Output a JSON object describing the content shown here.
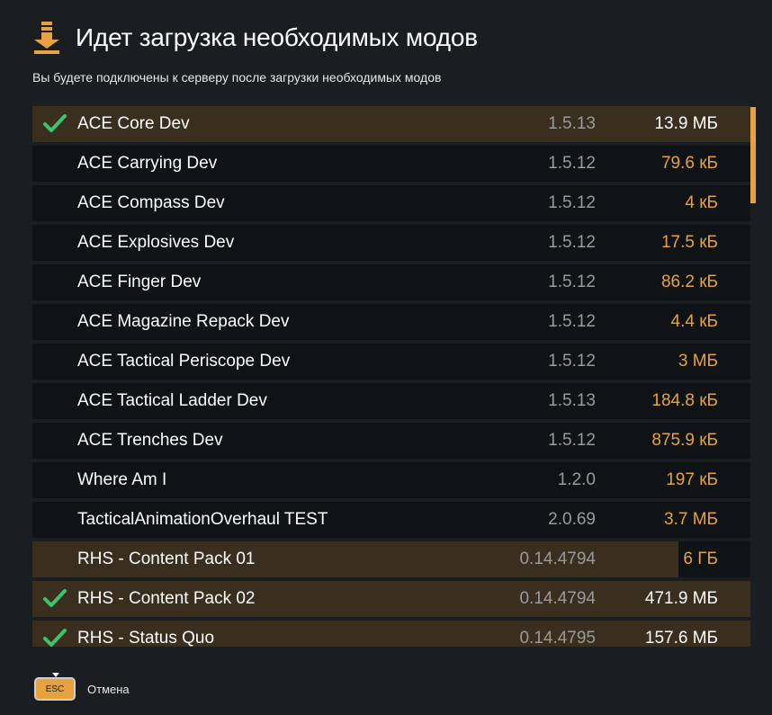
{
  "header": {
    "icon": "download-arrow-icon",
    "title": "Идет загрузка необходимых модов",
    "subtitle": "Вы будете подключены к серверу после загрузки необходимых модов"
  },
  "colors": {
    "accent": "#e6a23f",
    "check": "#3fc36a",
    "row_bg": "#0f1315",
    "row_progress": "#3a2f1e",
    "version_text": "#9a9a9a"
  },
  "mods": [
    {
      "name": "ACE Core Dev",
      "version": "1.5.13",
      "size": "13.9 МБ",
      "done": true,
      "progress": 1.0
    },
    {
      "name": "ACE Carrying Dev",
      "version": "1.5.12",
      "size": "79.6 кБ",
      "done": false,
      "progress": 0
    },
    {
      "name": "ACE Compass Dev",
      "version": "1.5.12",
      "size": "4 кБ",
      "done": false,
      "progress": 0
    },
    {
      "name": "ACE Explosives Dev",
      "version": "1.5.12",
      "size": "17.5 кБ",
      "done": false,
      "progress": 0
    },
    {
      "name": "ACE Finger Dev",
      "version": "1.5.12",
      "size": "86.2 кБ",
      "done": false,
      "progress": 0
    },
    {
      "name": "ACE Magazine Repack Dev",
      "version": "1.5.12",
      "size": "4.4 кБ",
      "done": false,
      "progress": 0
    },
    {
      "name": "ACE Tactical Periscope Dev",
      "version": "1.5.12",
      "size": "3 МБ",
      "done": false,
      "progress": 0
    },
    {
      "name": "ACE Tactical Ladder Dev",
      "version": "1.5.13",
      "size": "184.8 кБ",
      "done": false,
      "progress": 0
    },
    {
      "name": "ACE Trenches Dev",
      "version": "1.5.12",
      "size": "875.9 кБ",
      "done": false,
      "progress": 0
    },
    {
      "name": "Where Am I",
      "version": "1.2.0",
      "size": "197 кБ",
      "done": false,
      "progress": 0
    },
    {
      "name": "TacticalAnimationOverhaul TEST",
      "version": "2.0.69",
      "size": "3.7 МБ",
      "done": false,
      "progress": 0
    },
    {
      "name": "RHS - Content Pack 01",
      "version": "0.14.4794",
      "size": "6 ГБ",
      "done": false,
      "progress": 0.9
    },
    {
      "name": "RHS - Content Pack 02",
      "version": "0.14.4794",
      "size": "471.9 МБ",
      "done": true,
      "progress": 1.0
    },
    {
      "name": "RHS - Status Quo",
      "version": "0.14.4795",
      "size": "157.6 МБ",
      "done": true,
      "progress": 1.0
    }
  ],
  "footer": {
    "esc_key": "ESC",
    "cancel_label": "Отмена"
  }
}
